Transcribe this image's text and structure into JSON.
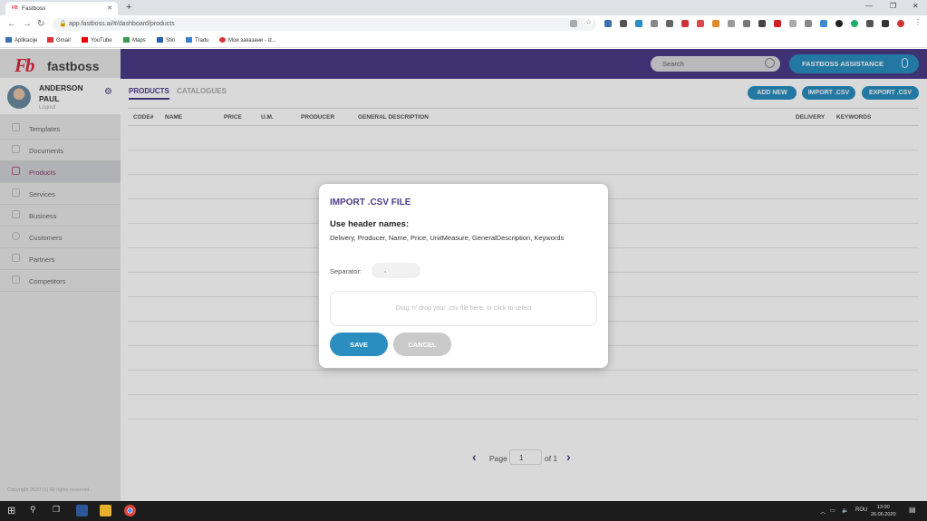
{
  "browser": {
    "tab_title": "Fastboss",
    "url": "app.fastboss.ai/#/dashboard/products",
    "bookmarks": [
      "Aplikacije",
      "Gmail",
      "YouTube",
      "Maps",
      "Stiri",
      "Tradu",
      "Мои заказани - iz..."
    ]
  },
  "app": {
    "logo_text": "fastboss",
    "user": {
      "name": "ANDERSON PAUL",
      "logout": "Logout"
    },
    "menu": [
      {
        "label": "Templates",
        "active": false
      },
      {
        "label": "Documents",
        "active": false
      },
      {
        "label": "Products",
        "active": true
      },
      {
        "label": "Services",
        "active": false
      },
      {
        "label": "Business",
        "active": false
      },
      {
        "label": "Customers",
        "active": false
      },
      {
        "label": "Partners",
        "active": false
      },
      {
        "label": "Competitors",
        "active": false
      }
    ],
    "copyright": "Copyright 2020 (c) All rights reserved",
    "search_placeholder": "Search",
    "assistance_label": "FASTBOSS ASSISTANCE"
  },
  "products": {
    "tabs": [
      "PRODUCTS",
      "CATALOGUES"
    ],
    "actions": {
      "add_new": "ADD NEW",
      "import": "IMPORT .CSV",
      "export": "EXPORT .CSV"
    },
    "columns": [
      "CODE#",
      "NAME",
      "PRICE",
      "U.M.",
      "PRODUCER",
      "GENERAL DESCRIPTION",
      "DELIVERY",
      "KEYWORDS"
    ],
    "pager": {
      "page_label": "Page",
      "page": "1",
      "of_label": "of 1"
    }
  },
  "modal": {
    "title": "IMPORT .CSV FILE",
    "header_title": "Use header names:",
    "header_fields": "Delivery, Producer, Name, Price, UnitMeasure, GeneralDescription, Keywords",
    "separator_label": "Separator:",
    "separator_value": ",",
    "dropzone_text": "Drag 'n' drop your .csv file here, or click to select",
    "save": "SAVE",
    "cancel": "CANCEL"
  },
  "taskbar": {
    "time": "13:00",
    "date": "26.06.2020",
    "lang": "ROU"
  },
  "colors": {
    "primary": "#4b3b86",
    "accent": "#2a8ec0",
    "brand_red": "#d7263d"
  }
}
